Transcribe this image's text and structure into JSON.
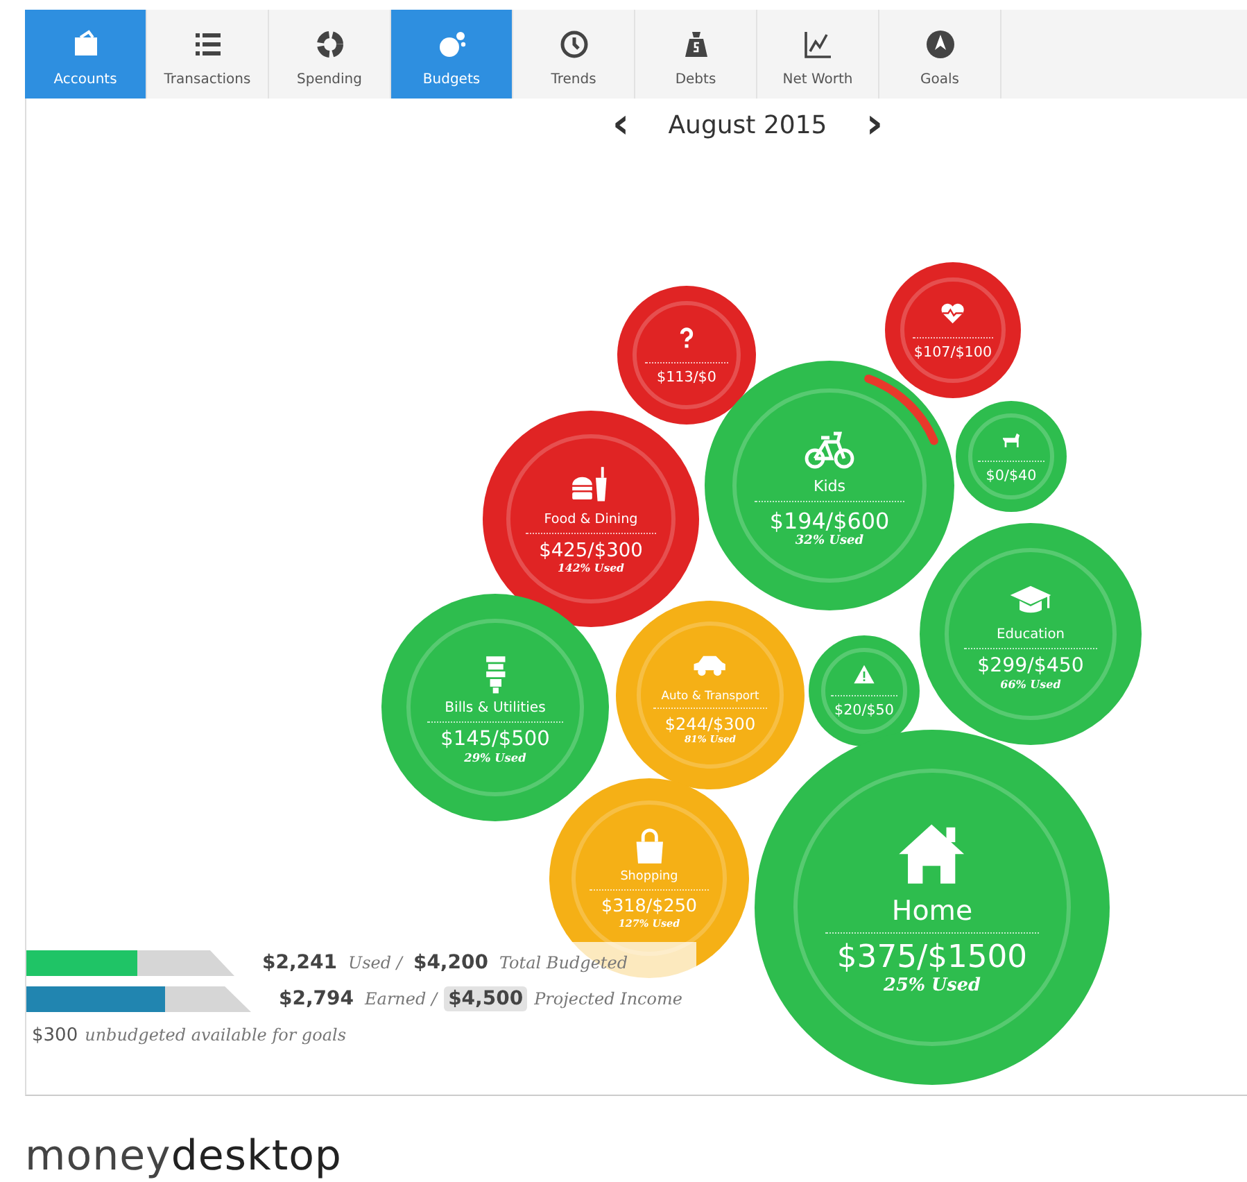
{
  "tabs": [
    {
      "label": "Accounts",
      "selected": true
    },
    {
      "label": "Transactions",
      "selected": false
    },
    {
      "label": "Spending",
      "selected": false
    },
    {
      "label": "Budgets",
      "selected": true
    },
    {
      "label": "Trends",
      "selected": false
    },
    {
      "label": "Debts",
      "selected": false
    },
    {
      "label": "Net Worth",
      "selected": false
    },
    {
      "label": "Goals",
      "selected": false
    }
  ],
  "month": {
    "prev": "‹",
    "label": "August 2015",
    "next": "›"
  },
  "bubbles": [
    {
      "amount": "$113/$0",
      "color": "#e02424"
    },
    {
      "amount": "$107/$100",
      "color": "#e02424"
    },
    {
      "name": "Food & Dining",
      "amount": "$425/$300",
      "used": "142% Used",
      "color": "#e02424"
    },
    {
      "name": "Kids",
      "amount": "$194/$600",
      "used": "32% Used",
      "color": "#2ebd4e"
    },
    {
      "amount": "$0/$40",
      "color": "#2ebd4e"
    },
    {
      "name": "Education",
      "amount": "$299/$450",
      "used": "66% Used",
      "color": "#2ebd4e"
    },
    {
      "name": "Bills & Utilities",
      "amount": "$145/$500",
      "used": "29% Used",
      "color": "#2ebd4e"
    },
    {
      "name": "Auto & Transport",
      "amount": "$244/$300",
      "used": "81% Used",
      "color": "#f5b016"
    },
    {
      "amount": "$20/$50",
      "color": "#2ebd4e"
    },
    {
      "name": "Shopping",
      "amount": "$318/$250",
      "used": "127% Used",
      "color": "#f5b016"
    },
    {
      "name": "Home",
      "amount": "$375/$1500",
      "used": "25% Used",
      "color": "#2ebd4e"
    }
  ],
  "summary": [
    {
      "level": 0.53,
      "color": "#1fc466",
      "amount": "$2,241",
      "amount_label": "Used /",
      "total": "$4,200",
      "total_label": "Total Budgeted",
      "highlighted": false
    },
    {
      "level": 0.62,
      "color": "#2185b0",
      "amount": "$2,794",
      "amount_label": "Earned /",
      "total": "$4,500",
      "total_label": "Projected Income",
      "highlighted": true
    }
  ],
  "unbudgeted": {
    "amount": "$300",
    "label": "unbudgeted available for goals"
  },
  "logo": {
    "light": "money",
    "bold": "desktop"
  }
}
